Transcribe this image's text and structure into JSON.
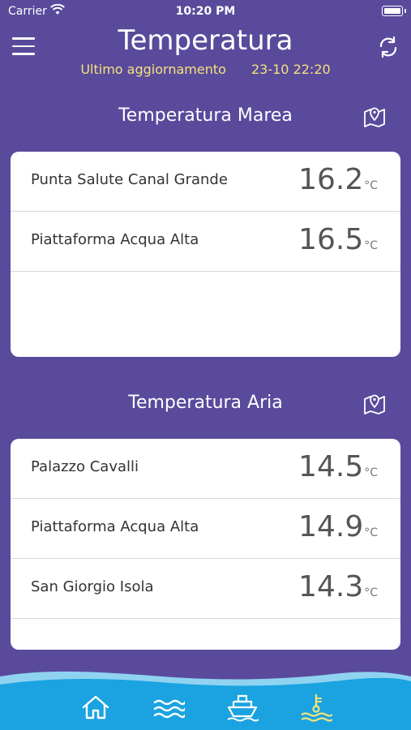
{
  "status": {
    "carrier": "Carrier",
    "time": "10:20 PM"
  },
  "header": {
    "title": "Temperatura",
    "update_label": "Ultimo aggiornamento",
    "update_time": "23-10 22:20"
  },
  "sections": [
    {
      "title": "Temperatura Marea",
      "rows": [
        {
          "name": "Punta Salute Canal Grande",
          "value": "16.2",
          "unit": "°C"
        },
        {
          "name": "Piattaforma Acqua Alta",
          "value": "16.5",
          "unit": "°C"
        }
      ]
    },
    {
      "title": "Temperatura Aria",
      "rows": [
        {
          "name": "Palazzo Cavalli",
          "value": "14.5",
          "unit": "°C"
        },
        {
          "name": "Piattaforma Acqua Alta",
          "value": "14.9",
          "unit": "°C"
        },
        {
          "name": "San Giorgio Isola",
          "value": "14.3",
          "unit": "°C"
        }
      ]
    }
  ],
  "nav": {
    "items": [
      {
        "icon": "home-icon",
        "active": false
      },
      {
        "icon": "waves-icon",
        "active": false
      },
      {
        "icon": "boat-icon",
        "active": false
      },
      {
        "icon": "thermometer-water-icon",
        "active": true
      }
    ],
    "active_color": "#f4e27a",
    "inactive_color": "#ffffff"
  },
  "colors": {
    "background": "#5a4a9c",
    "accent": "#f4e27a",
    "nav_blue": "#1aa3e0"
  }
}
